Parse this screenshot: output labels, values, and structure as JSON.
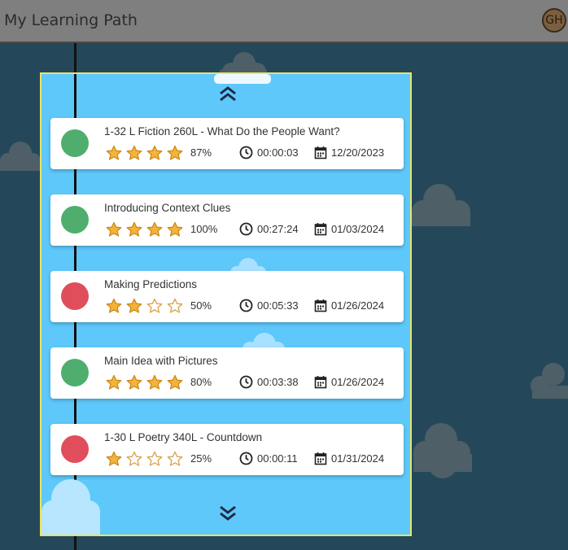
{
  "header": {
    "title": "My Learning Path",
    "avatar_initials": "GH"
  },
  "colors": {
    "completed": "#4fae6e",
    "incomplete": "#e04d5b",
    "star": "#f2b43a"
  },
  "nav": {
    "up_icon": "chevron-double-up-icon",
    "down_icon": "chevron-double-down-icon"
  },
  "lessons": [
    {
      "title": "1-32 L Fiction 260L - What Do the People Want?",
      "status": "completed",
      "stars": 4,
      "score": "87%",
      "time": "00:00:03",
      "date": "12/20/2023"
    },
    {
      "title": "Introducing Context Clues",
      "status": "completed",
      "stars": 4,
      "score": "100%",
      "time": "00:27:24",
      "date": "01/03/2024"
    },
    {
      "title": "Making Predictions",
      "status": "incomplete",
      "stars": 2,
      "score": "50%",
      "time": "00:05:33",
      "date": "01/26/2024"
    },
    {
      "title": "Main Idea with Pictures",
      "status": "completed",
      "stars": 4,
      "score": "80%",
      "time": "00:03:38",
      "date": "01/26/2024"
    },
    {
      "title": "1-30 L Poetry 340L - Countdown",
      "status": "incomplete",
      "stars": 1,
      "score": "25%",
      "time": "00:00:11",
      "date": "01/31/2024"
    }
  ]
}
